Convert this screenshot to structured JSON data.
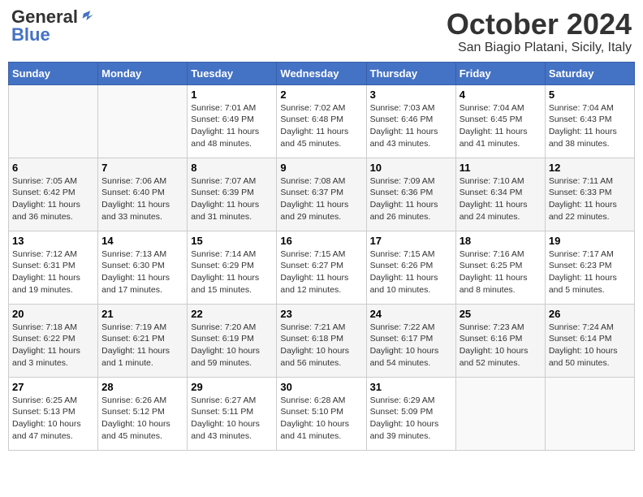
{
  "header": {
    "logo_general": "General",
    "logo_blue": "Blue",
    "month": "October 2024",
    "location": "San Biagio Platani, Sicily, Italy"
  },
  "days_of_week": [
    "Sunday",
    "Monday",
    "Tuesday",
    "Wednesday",
    "Thursday",
    "Friday",
    "Saturday"
  ],
  "weeks": [
    [
      {
        "day": "",
        "info": ""
      },
      {
        "day": "",
        "info": ""
      },
      {
        "day": "1",
        "info": "Sunrise: 7:01 AM\nSunset: 6:49 PM\nDaylight: 11 hours and 48 minutes."
      },
      {
        "day": "2",
        "info": "Sunrise: 7:02 AM\nSunset: 6:48 PM\nDaylight: 11 hours and 45 minutes."
      },
      {
        "day": "3",
        "info": "Sunrise: 7:03 AM\nSunset: 6:46 PM\nDaylight: 11 hours and 43 minutes."
      },
      {
        "day": "4",
        "info": "Sunrise: 7:04 AM\nSunset: 6:45 PM\nDaylight: 11 hours and 41 minutes."
      },
      {
        "day": "5",
        "info": "Sunrise: 7:04 AM\nSunset: 6:43 PM\nDaylight: 11 hours and 38 minutes."
      }
    ],
    [
      {
        "day": "6",
        "info": "Sunrise: 7:05 AM\nSunset: 6:42 PM\nDaylight: 11 hours and 36 minutes."
      },
      {
        "day": "7",
        "info": "Sunrise: 7:06 AM\nSunset: 6:40 PM\nDaylight: 11 hours and 33 minutes."
      },
      {
        "day": "8",
        "info": "Sunrise: 7:07 AM\nSunset: 6:39 PM\nDaylight: 11 hours and 31 minutes."
      },
      {
        "day": "9",
        "info": "Sunrise: 7:08 AM\nSunset: 6:37 PM\nDaylight: 11 hours and 29 minutes."
      },
      {
        "day": "10",
        "info": "Sunrise: 7:09 AM\nSunset: 6:36 PM\nDaylight: 11 hours and 26 minutes."
      },
      {
        "day": "11",
        "info": "Sunrise: 7:10 AM\nSunset: 6:34 PM\nDaylight: 11 hours and 24 minutes."
      },
      {
        "day": "12",
        "info": "Sunrise: 7:11 AM\nSunset: 6:33 PM\nDaylight: 11 hours and 22 minutes."
      }
    ],
    [
      {
        "day": "13",
        "info": "Sunrise: 7:12 AM\nSunset: 6:31 PM\nDaylight: 11 hours and 19 minutes."
      },
      {
        "day": "14",
        "info": "Sunrise: 7:13 AM\nSunset: 6:30 PM\nDaylight: 11 hours and 17 minutes."
      },
      {
        "day": "15",
        "info": "Sunrise: 7:14 AM\nSunset: 6:29 PM\nDaylight: 11 hours and 15 minutes."
      },
      {
        "day": "16",
        "info": "Sunrise: 7:15 AM\nSunset: 6:27 PM\nDaylight: 11 hours and 12 minutes."
      },
      {
        "day": "17",
        "info": "Sunrise: 7:15 AM\nSunset: 6:26 PM\nDaylight: 11 hours and 10 minutes."
      },
      {
        "day": "18",
        "info": "Sunrise: 7:16 AM\nSunset: 6:25 PM\nDaylight: 11 hours and 8 minutes."
      },
      {
        "day": "19",
        "info": "Sunrise: 7:17 AM\nSunset: 6:23 PM\nDaylight: 11 hours and 5 minutes."
      }
    ],
    [
      {
        "day": "20",
        "info": "Sunrise: 7:18 AM\nSunset: 6:22 PM\nDaylight: 11 hours and 3 minutes."
      },
      {
        "day": "21",
        "info": "Sunrise: 7:19 AM\nSunset: 6:21 PM\nDaylight: 11 hours and 1 minute."
      },
      {
        "day": "22",
        "info": "Sunrise: 7:20 AM\nSunset: 6:19 PM\nDaylight: 10 hours and 59 minutes."
      },
      {
        "day": "23",
        "info": "Sunrise: 7:21 AM\nSunset: 6:18 PM\nDaylight: 10 hours and 56 minutes."
      },
      {
        "day": "24",
        "info": "Sunrise: 7:22 AM\nSunset: 6:17 PM\nDaylight: 10 hours and 54 minutes."
      },
      {
        "day": "25",
        "info": "Sunrise: 7:23 AM\nSunset: 6:16 PM\nDaylight: 10 hours and 52 minutes."
      },
      {
        "day": "26",
        "info": "Sunrise: 7:24 AM\nSunset: 6:14 PM\nDaylight: 10 hours and 50 minutes."
      }
    ],
    [
      {
        "day": "27",
        "info": "Sunrise: 6:25 AM\nSunset: 5:13 PM\nDaylight: 10 hours and 47 minutes."
      },
      {
        "day": "28",
        "info": "Sunrise: 6:26 AM\nSunset: 5:12 PM\nDaylight: 10 hours and 45 minutes."
      },
      {
        "day": "29",
        "info": "Sunrise: 6:27 AM\nSunset: 5:11 PM\nDaylight: 10 hours and 43 minutes."
      },
      {
        "day": "30",
        "info": "Sunrise: 6:28 AM\nSunset: 5:10 PM\nDaylight: 10 hours and 41 minutes."
      },
      {
        "day": "31",
        "info": "Sunrise: 6:29 AM\nSunset: 5:09 PM\nDaylight: 10 hours and 39 minutes."
      },
      {
        "day": "",
        "info": ""
      },
      {
        "day": "",
        "info": ""
      }
    ]
  ]
}
